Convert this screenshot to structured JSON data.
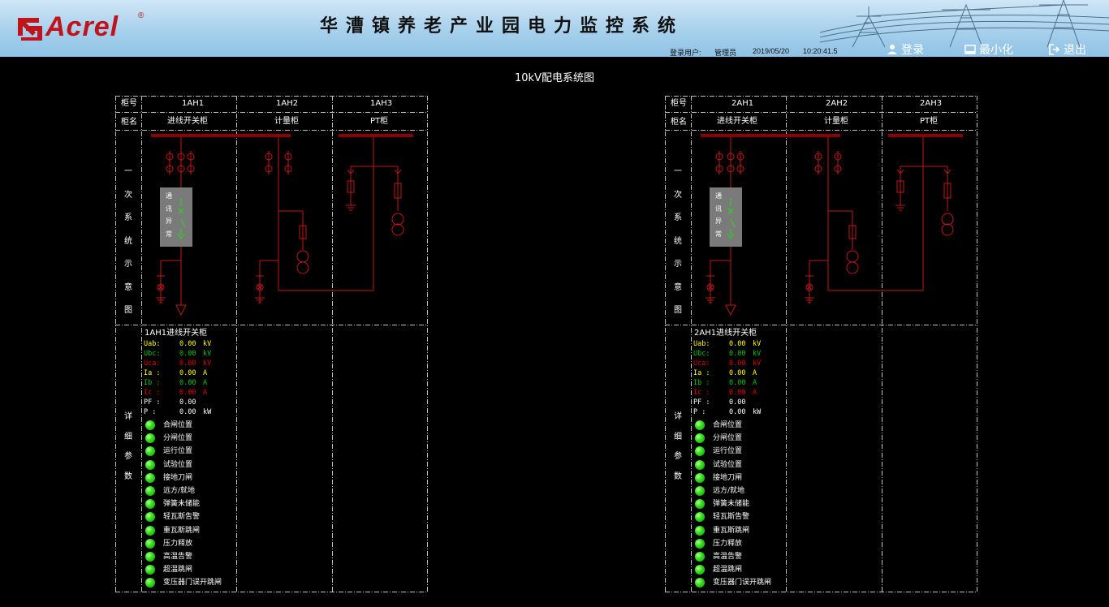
{
  "header": {
    "logo_text": "Acrel",
    "logo_mark": "®",
    "title": "华漕镇养老产业园电力监控系统",
    "login_user_label": "登录用户:",
    "login_user": "管理员",
    "date": "2019/05/20",
    "time": "10:20:41.5",
    "btn_login": "登录",
    "btn_minimize": "最小化",
    "btn_exit": "退出"
  },
  "page_title": "10kV配电系统图",
  "panels": [
    {
      "row_label_no": "柜号",
      "row_label_name": "柜名",
      "section_diagram": [
        "一",
        "次",
        "系",
        "统",
        "示",
        "意",
        "图"
      ],
      "section_params": [
        "详",
        "细",
        "参",
        "数"
      ],
      "cabinets": [
        {
          "no": "1AH1",
          "name": "进线开关柜"
        },
        {
          "no": "1AH2",
          "name": "计量柜"
        },
        {
          "no": "1AH3",
          "name": "PT柜"
        }
      ],
      "comm_abnormal": [
        "通",
        "讯",
        "异",
        "常"
      ],
      "detail_title": "1AH1进线开关柜",
      "measurements": [
        {
          "label": "Uab:",
          "value": "0.00",
          "unit": "kV",
          "color": "#ffff00"
        },
        {
          "label": "Ubc:",
          "value": "0.00",
          "unit": "kV",
          "color": "#00c800"
        },
        {
          "label": "Uca:",
          "value": "0.00",
          "unit": "kV",
          "color": "#e00000"
        },
        {
          "label": "Ia :",
          "value": "0.00",
          "unit": "A",
          "color": "#ffff00"
        },
        {
          "label": "Ib :",
          "value": "0.00",
          "unit": "A",
          "color": "#00c800"
        },
        {
          "label": "Ic :",
          "value": "0.00",
          "unit": "A",
          "color": "#e00000"
        },
        {
          "label": "PF :",
          "value": "0.00",
          "unit": "",
          "color": "#ffffff"
        },
        {
          "label": "P  :",
          "value": "0.00",
          "unit": "kW",
          "color": "#ffffff"
        }
      ],
      "statuses": [
        "合闸位置",
        "分闸位置",
        "运行位置",
        "试验位置",
        "接地刀闸",
        "远方/就地",
        "弹簧未储能",
        "轻瓦斯告警",
        "重瓦斯跳闸",
        "压力释放",
        "高温告警",
        "超温跳闸",
        "变压器门误开跳闸"
      ]
    },
    {
      "row_label_no": "柜号",
      "row_label_name": "柜名",
      "section_diagram": [
        "一",
        "次",
        "系",
        "统",
        "示",
        "意",
        "图"
      ],
      "section_params": [
        "详",
        "细",
        "参",
        "数"
      ],
      "cabinets": [
        {
          "no": "2AH1",
          "name": "进线开关柜"
        },
        {
          "no": "2AH2",
          "name": "计量柜"
        },
        {
          "no": "2AH3",
          "name": "PT柜"
        }
      ],
      "comm_abnormal": [
        "通",
        "讯",
        "异",
        "常"
      ],
      "detail_title": "2AH1进线开关柜",
      "measurements": [
        {
          "label": "Uab:",
          "value": "0.00",
          "unit": "kV",
          "color": "#ffff00"
        },
        {
          "label": "Ubc:",
          "value": "0.00",
          "unit": "kV",
          "color": "#00c800"
        },
        {
          "label": "Uca:",
          "value": "0.00",
          "unit": "kV",
          "color": "#e00000"
        },
        {
          "label": "Ia :",
          "value": "0.00",
          "unit": "A",
          "color": "#ffff00"
        },
        {
          "label": "Ib :",
          "value": "0.00",
          "unit": "A",
          "color": "#00c800"
        },
        {
          "label": "Ic :",
          "value": "0.00",
          "unit": "A",
          "color": "#e00000"
        },
        {
          "label": "PF :",
          "value": "0.00",
          "unit": "",
          "color": "#ffffff"
        },
        {
          "label": "P  :",
          "value": "0.00",
          "unit": "kW",
          "color": "#ffffff"
        }
      ],
      "statuses": [
        "合闸位置",
        "分闸位置",
        "运行位置",
        "试验位置",
        "接地刀闸",
        "远方/就地",
        "弹簧未储能",
        "轻瓦斯告警",
        "重瓦斯跳闸",
        "压力释放",
        "高温告警",
        "超温跳闸",
        "变压器门误开跳闸"
      ]
    }
  ],
  "colors": {
    "busbar": "#8b0000",
    "wire": "#c01818",
    "grid": "#bfbfbf",
    "status_on": "#22dd11",
    "switch": "#22dd11"
  }
}
